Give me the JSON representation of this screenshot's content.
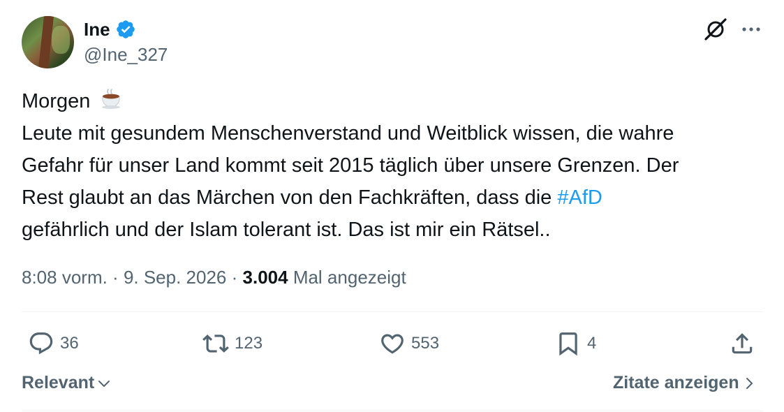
{
  "author": {
    "display_name": "Ine",
    "handle": "@Ine_327",
    "verified_icon": "verified-badge-icon",
    "badge_color": "#1d9bf0"
  },
  "header_icons": [
    "grok-icon",
    "more-icon"
  ],
  "tweet": {
    "line1_text": "Morgen",
    "line1_emoji": "hot-beverage-icon",
    "line2": "Leute mit gesundem Menschenverstand und Weitblick wissen, die wahre",
    "line3": "Gefahr für unser Land kommt seit 2015 täglich über unsere Grenzen. Der",
    "line4_before": "Rest glaubt an das Märchen von den Fachkräften, dass die ",
    "hashtag": "#AfD",
    "line5": "gefährlich und der Islam tolerant ist. Das ist mir ein Rätsel.."
  },
  "meta": {
    "time": "8:08 vorm.",
    "sep1": " · ",
    "date": "9. Sep. 2026",
    "sep2": " · ",
    "views": "3.004",
    "views_label": " Mal angezeigt"
  },
  "actions": {
    "replies": "36",
    "reposts": "123",
    "likes": "553",
    "bookmarks": "4"
  },
  "footer": {
    "sort_label": "Relevant",
    "quotes_label": "Zitate anzeigen"
  },
  "colors": {
    "text": "#0f1419",
    "secondary": "#536471",
    "link": "#1d9bf0",
    "divider": "#eff3f4"
  }
}
